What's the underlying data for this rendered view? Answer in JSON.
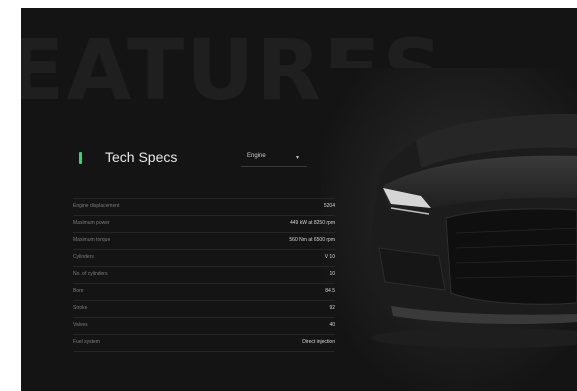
{
  "hero": {
    "watermark": "EATURES"
  },
  "specs_panel": {
    "title": "Tech Specs",
    "dropdown": {
      "selected": "Engine",
      "caret": "▾"
    },
    "rows": [
      {
        "label": "Engine displacement",
        "value": "5204"
      },
      {
        "label": "Maximum power",
        "value": "449 kW at 8250 rpm"
      },
      {
        "label": "Maximum torque",
        "value": "560 Nm at 6500 rpm"
      },
      {
        "label": "Cylinders",
        "value": "V 10"
      },
      {
        "label": "No. of cylinders",
        "value": "10"
      },
      {
        "label": "Bore",
        "value": "84.5"
      },
      {
        "label": "Stroke",
        "value": "92"
      },
      {
        "label": "Valves",
        "value": "40"
      },
      {
        "label": "Fuel system",
        "value": "Direct injection"
      }
    ]
  },
  "colors": {
    "accent": "#3fd07a",
    "background": "#141414"
  }
}
